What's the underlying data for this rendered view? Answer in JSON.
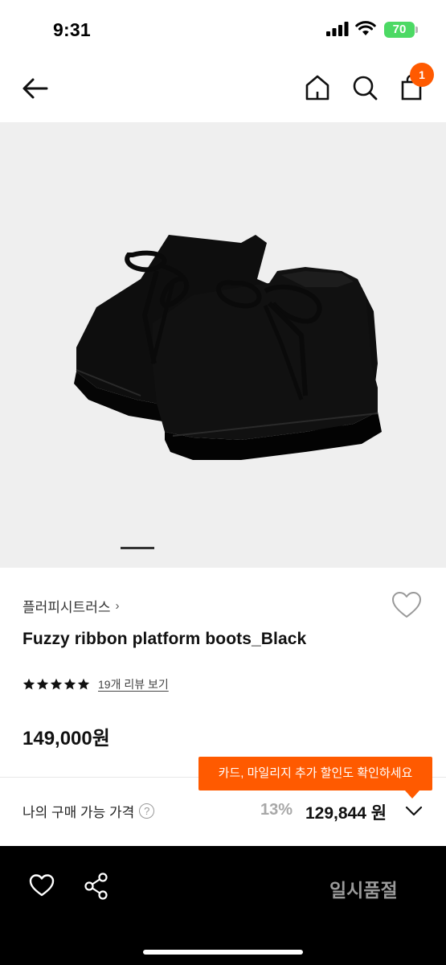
{
  "status_bar": {
    "time": "9:31",
    "battery": "70",
    "icons": [
      "signal-icon",
      "wifi-icon",
      "battery-icon"
    ]
  },
  "nav": {
    "icons": [
      "back-arrow-icon",
      "home-icon",
      "search-icon",
      "shopping-bag-icon"
    ],
    "cart_count": "1"
  },
  "product": {
    "image_subject": "black suede platform ankle boots with ribbon laces",
    "brand": "플러피시트러스",
    "brand_chevron": "›",
    "name": "Fuzzy ribbon platform boots_Black",
    "rating_stars": 5,
    "review_link": "19개 리뷰 보기",
    "price": "149,000원"
  },
  "promo": {
    "tooltip": "카드, 마일리지 추가 할인도 확인하세요"
  },
  "my_price": {
    "label": "나의 구매 가능 가격",
    "help": "?",
    "discount_rate": "13%",
    "discount_price": "129,844 원"
  },
  "bottom_bar": {
    "icons": [
      "heart-icon",
      "share-icon"
    ],
    "action_label": "일시품절"
  },
  "colors": {
    "accent": "#ff5a00",
    "bottom_bar": "#000000",
    "image_bg": "#efefef",
    "battery": "#4cd964"
  }
}
